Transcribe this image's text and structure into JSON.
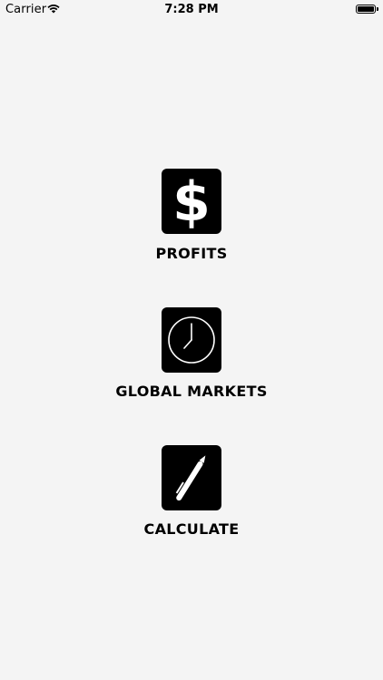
{
  "status_bar": {
    "carrier": "Carrier",
    "time": "7:28 PM"
  },
  "menu": {
    "items": [
      {
        "label": "PROFITS",
        "icon": "dollar-sign-icon"
      },
      {
        "label": "GLOBAL MARKETS",
        "icon": "clock-icon"
      },
      {
        "label": "CALCULATE",
        "icon": "pen-icon"
      }
    ]
  },
  "colors": {
    "background": "#f4f4f4",
    "tile": "#000000",
    "icon": "#ffffff",
    "text": "#000000"
  }
}
